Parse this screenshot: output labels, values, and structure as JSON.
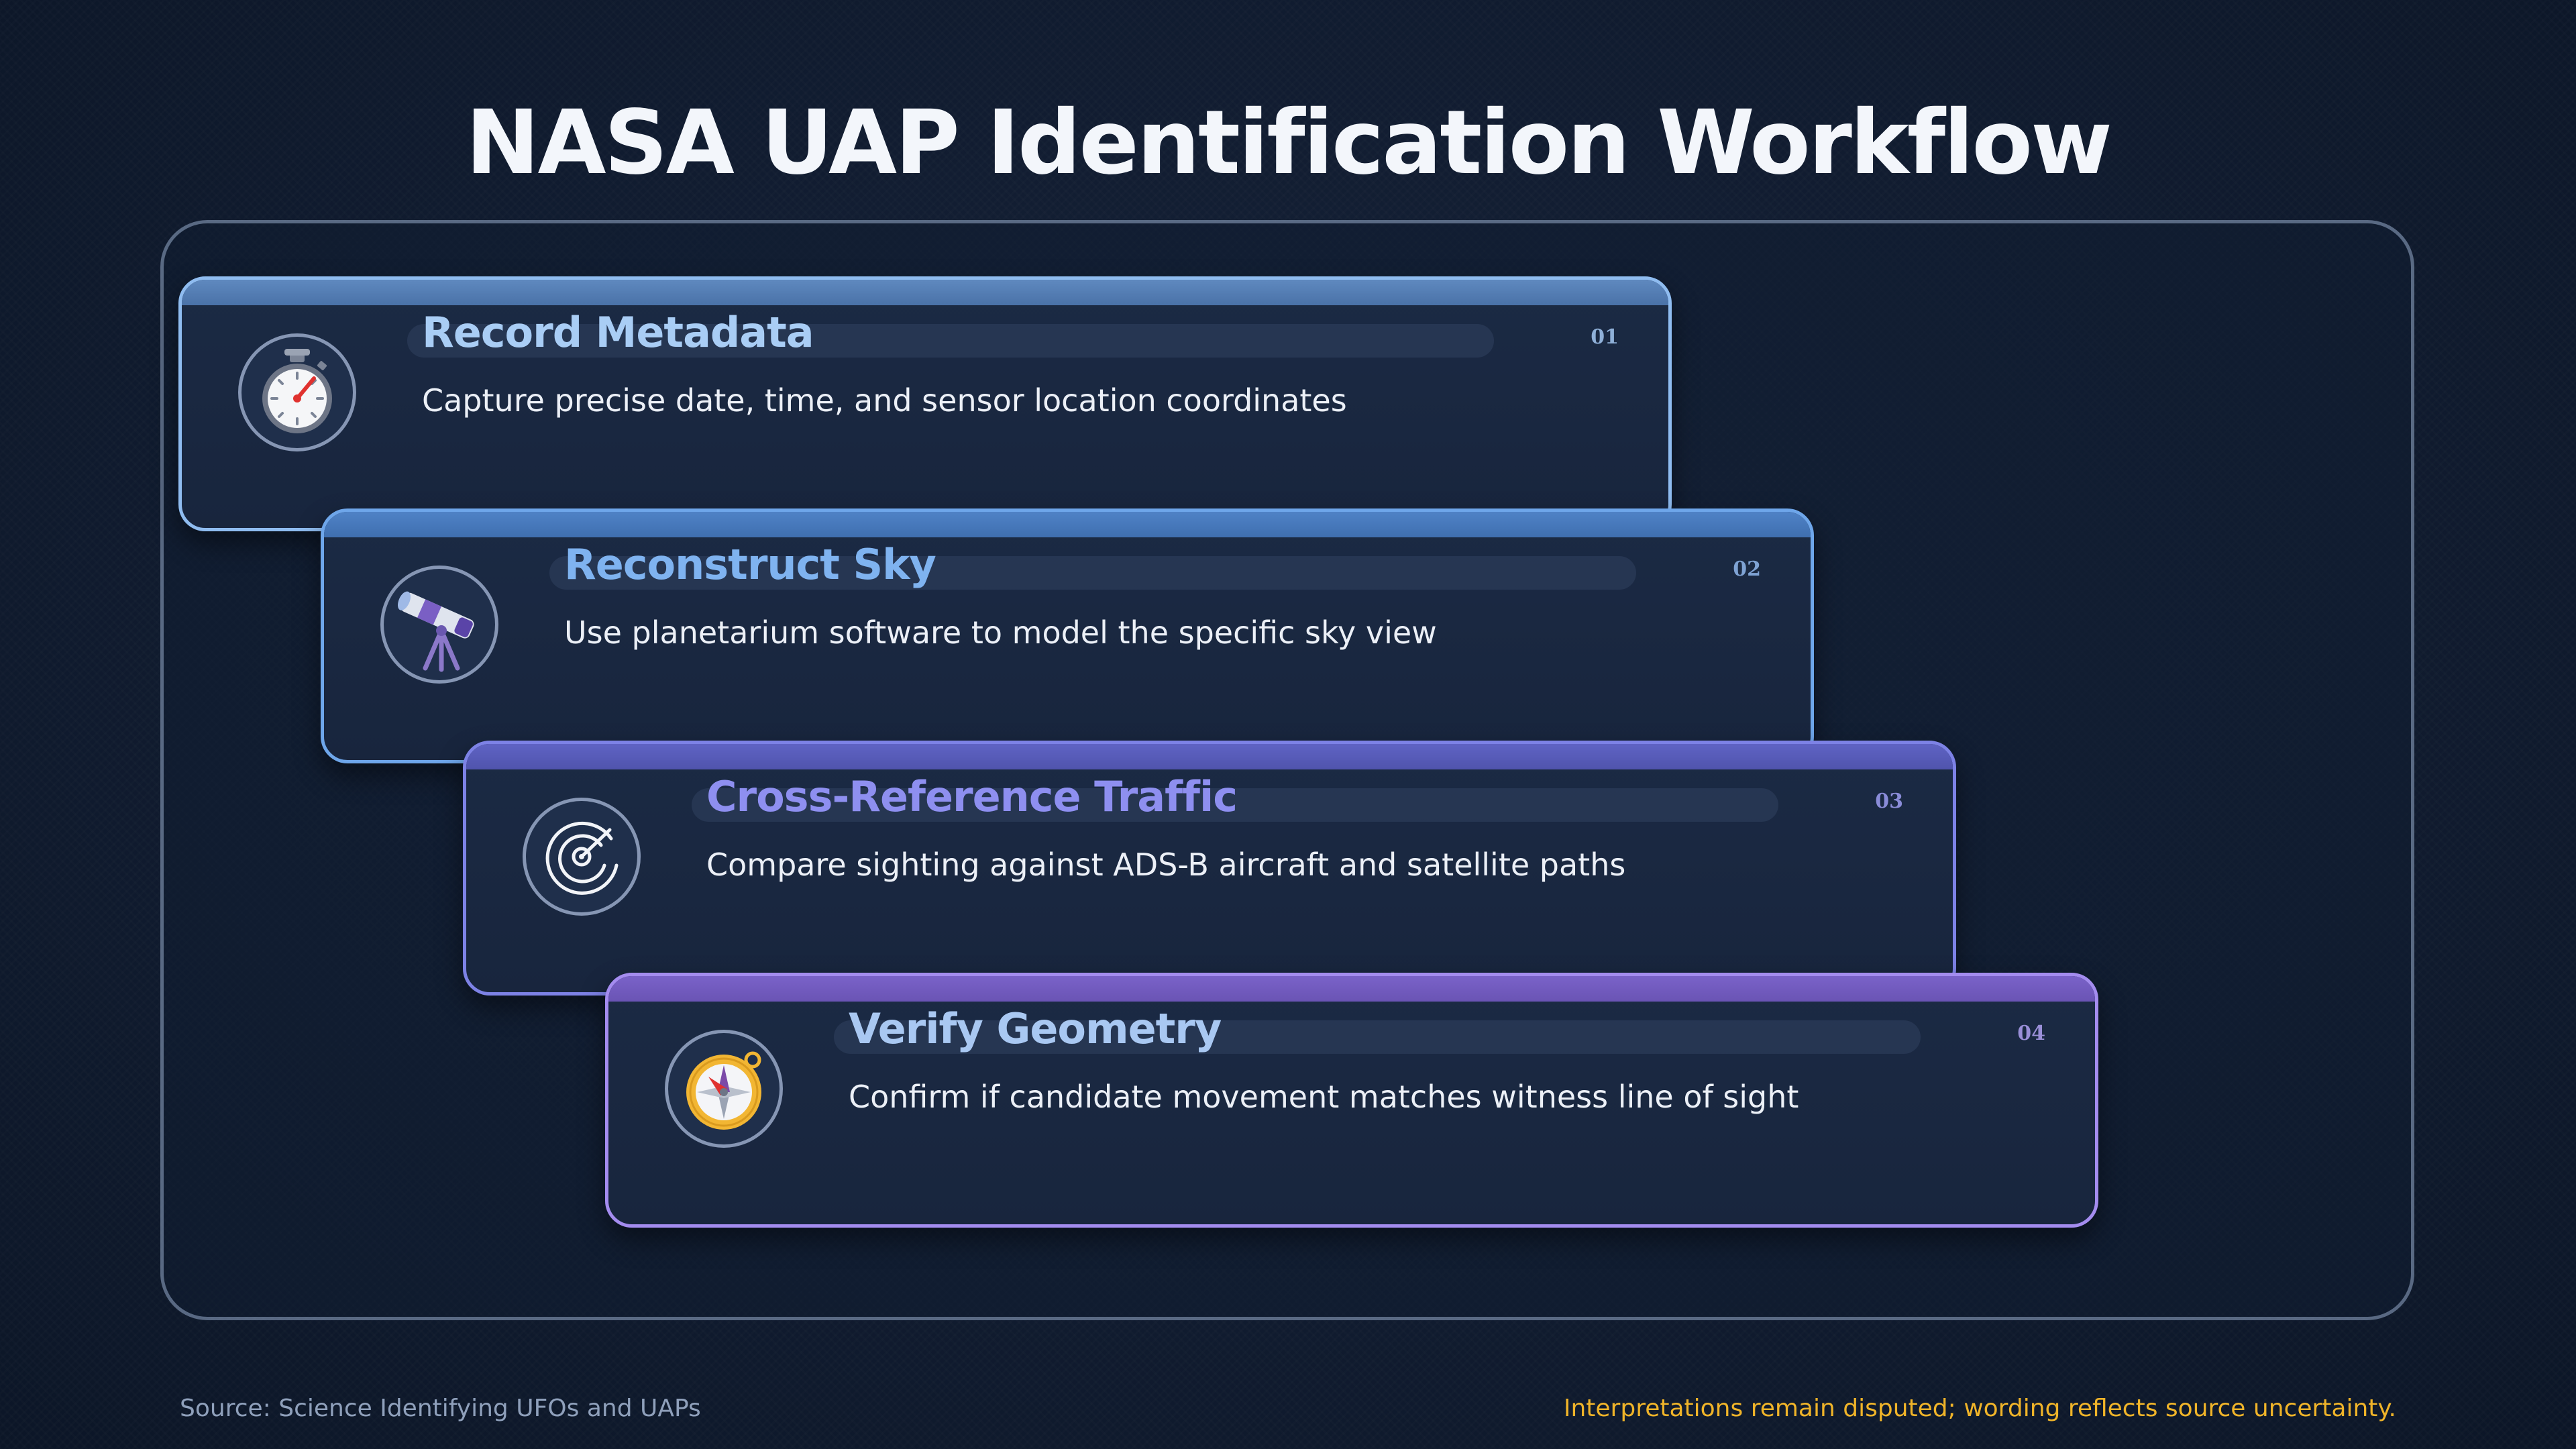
{
  "title": "NASA UAP Identification Workflow",
  "steps": [
    {
      "number": "01",
      "name": "Record Metadata",
      "description": "Capture precise date, time, and sensor location coordinates",
      "icon": "stopwatch-icon",
      "accent": "#a9cdf5"
    },
    {
      "number": "02",
      "name": "Reconstruct Sky",
      "description": "Use planetarium software to model the specific sky view",
      "icon": "telescope-icon",
      "accent": "#7fb3f0"
    },
    {
      "number": "03",
      "name": "Cross-Reference Traffic",
      "description": "Compare sighting against ADS-B aircraft and satellite paths",
      "icon": "radar-icon",
      "accent": "#8e8ff0"
    },
    {
      "number": "04",
      "name": "Verify Geometry",
      "description": "Confirm if candidate movement matches witness line of sight",
      "icon": "compass-icon",
      "accent": "#b2a2f3"
    }
  ],
  "footer": {
    "source": "Source: Science Identifying UFOs and UAPs",
    "note": "Interpretations remain disputed; wording reflects source uncertainty."
  },
  "colors": {
    "background": "#0f1a2e",
    "card": "#1b2a44",
    "note": "#f0b429",
    "source": "#8fa0bb"
  }
}
